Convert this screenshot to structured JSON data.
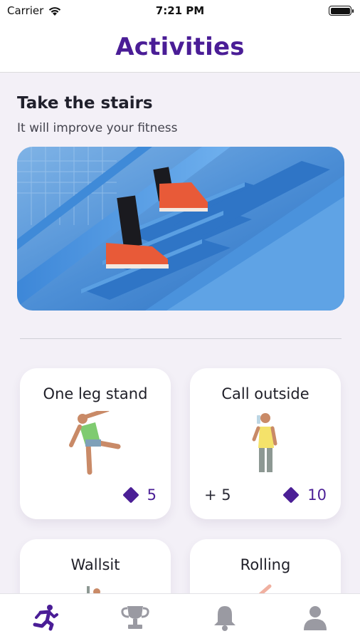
{
  "status": {
    "carrier": "Carrier",
    "time": "7:21 PM"
  },
  "header": {
    "title": "Activities"
  },
  "featured": {
    "title": "Take the stairs",
    "subtitle": "It will improve your fitness"
  },
  "cards": [
    {
      "title": "One leg stand",
      "bonus": "",
      "points": "5"
    },
    {
      "title": "Call outside",
      "bonus": "+ 5",
      "points": "10"
    },
    {
      "title": "Wallsit",
      "bonus": "",
      "points": ""
    },
    {
      "title": "Rolling",
      "bonus": "",
      "points": ""
    }
  ],
  "tabs": [
    {
      "icon": "runner-icon",
      "active": true
    },
    {
      "icon": "trophy-icon",
      "active": false
    },
    {
      "icon": "bell-icon",
      "active": false
    },
    {
      "icon": "profile-icon",
      "active": false
    }
  ],
  "colors": {
    "accent": "#4a1d96",
    "inactive_icon": "#9a9aa2",
    "background": "#f3f0f7"
  }
}
